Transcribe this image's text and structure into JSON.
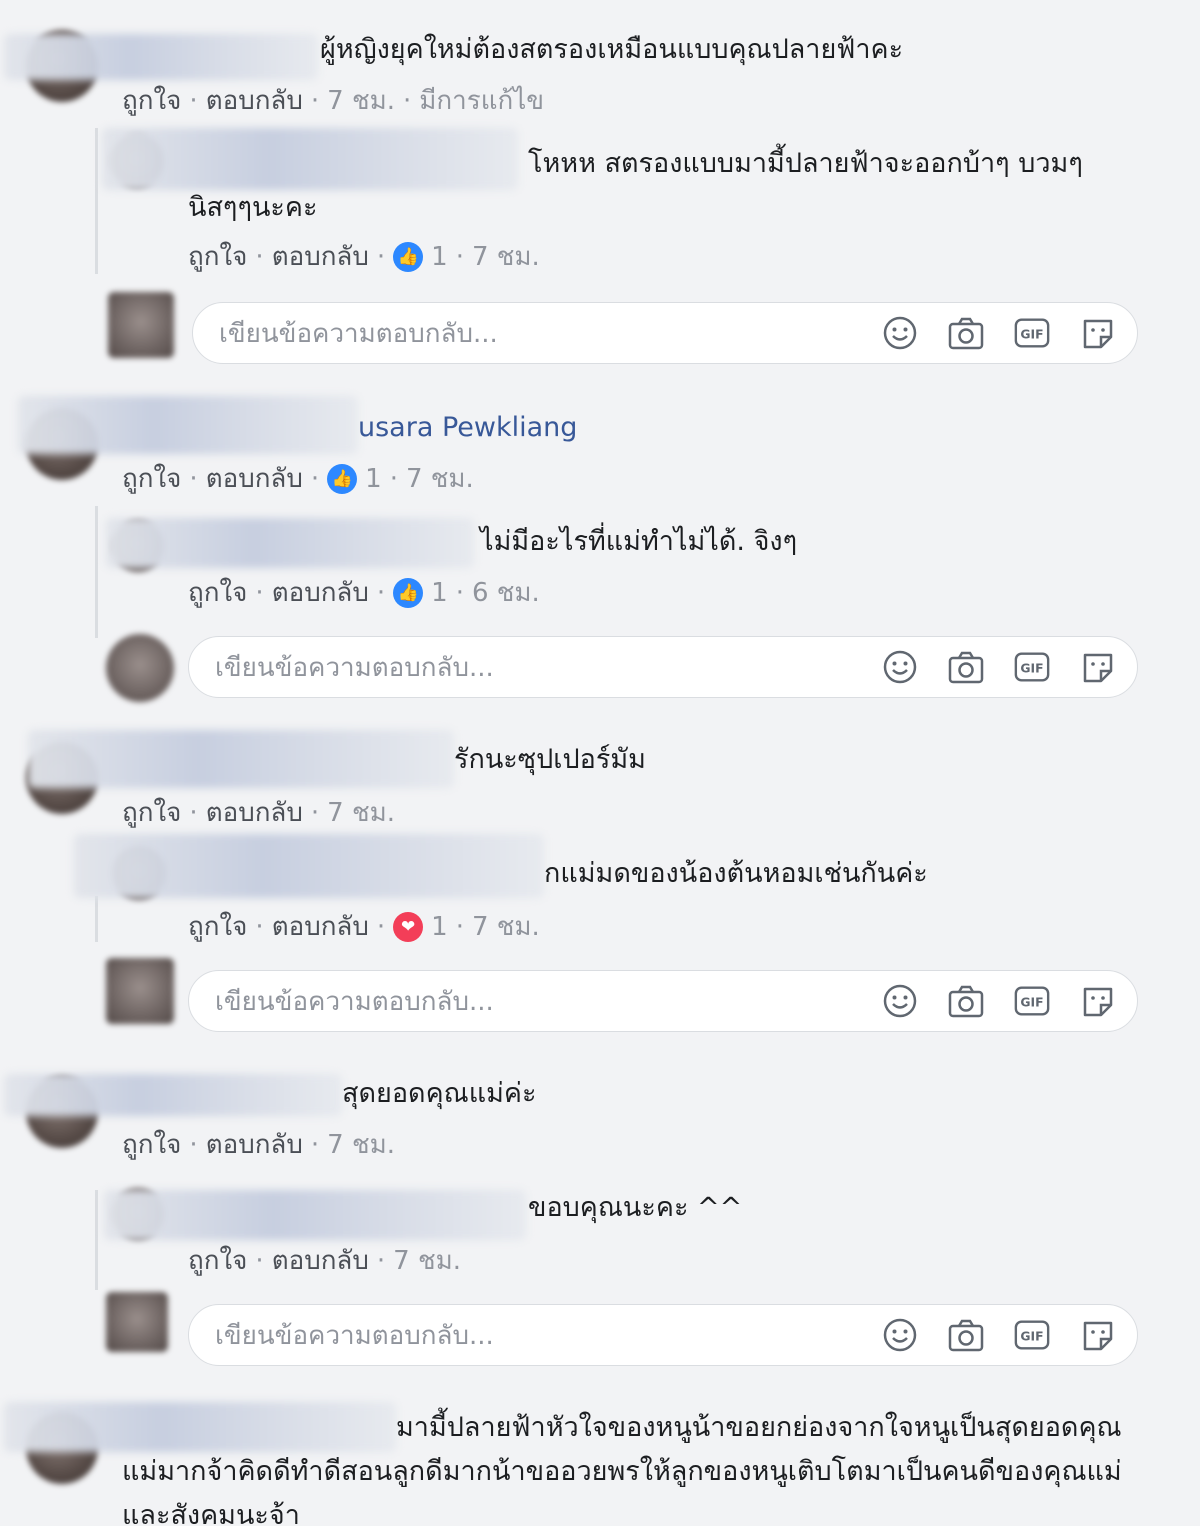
{
  "ui": {
    "like": "ถูกใจ",
    "reply": "ตอบกลับ",
    "edited": "มีการแก้ไข",
    "reply_placeholder": "เขียนข้อความตอบกลับ...",
    "gif": "GIF"
  },
  "comments": [
    {
      "text": "ผู้หญิงยุคใหม่ต้องสตรองเหมือนแบบคุณปลายฟ้าคะ",
      "time": "7 ชม.",
      "reply": {
        "text": "โหหห สตรองแบบมามี้ปลายฟ้าจะออกบ้าๆ บวมๆนิสๆๆนะคะ",
        "reaction_count": "1",
        "time": "7 ชม."
      }
    },
    {
      "text": "usara Pewkliang",
      "reaction_count": "1",
      "time": "7 ชม.",
      "reply": {
        "text": "ไม่มีอะไรที่แม่ทำไม่ได้. จิงๆ",
        "reaction_count": "1",
        "time": "6 ชม."
      }
    },
    {
      "text": "รักนะซุปเปอร์มัม",
      "time": "7 ชม.",
      "reply": {
        "text": "กแม่มดของน้องต้นหอมเช่นกันค่ะ",
        "reaction_count": "1",
        "time": "7 ชม."
      }
    },
    {
      "text": "สุดยอดคุณแม่ค่ะ",
      "time": "7 ชม.",
      "reply": {
        "text": "ขอบคุณนะคะ ^^",
        "time": "7 ชม."
      }
    },
    {
      "text": "มามี้ปลายฟ้าหัวใจของหนูน้าขอยกย่องจากใจหนูเป็นสุดยอดคุณแม่มากจ้าคิดดีทำดีสอนลูกดีมากน้าขออวยพรให้ลูกของหนูเติบโตมาเป็นคนดีของคุณแม่และสังคมนะจ้า"
    }
  ],
  "colors": {
    "background": "#f2f3f5",
    "link": "#385898",
    "like_blue": "#2d88ff",
    "love_red": "#f33e58"
  }
}
